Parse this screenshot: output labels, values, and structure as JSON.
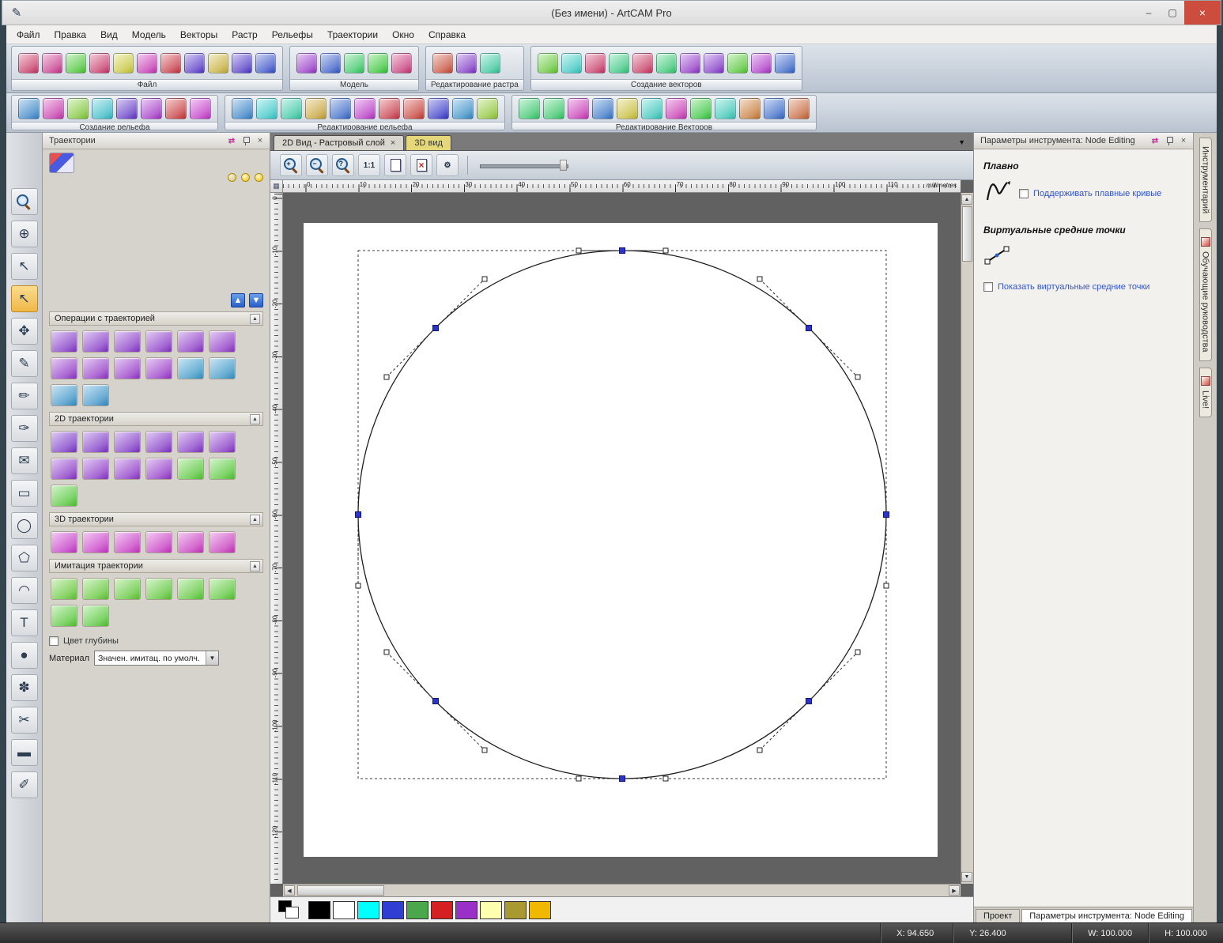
{
  "window": {
    "title": "(Без имени) - ArtCAM Pro"
  },
  "menu": {
    "items": [
      {
        "name": "file",
        "label": "Файл"
      },
      {
        "name": "edit",
        "label": "Правка"
      },
      {
        "name": "view",
        "label": "Вид"
      },
      {
        "name": "model",
        "label": "Модель"
      },
      {
        "name": "vectors",
        "label": "Векторы"
      },
      {
        "name": "bitmap",
        "label": "Растр"
      },
      {
        "name": "reliefs",
        "label": "Рельефы"
      },
      {
        "name": "toolpaths",
        "label": "Траектории"
      },
      {
        "name": "window",
        "label": "Окно"
      },
      {
        "name": "help",
        "label": "Справка"
      }
    ]
  },
  "toolbar_row1": {
    "groups": [
      {
        "label": "Файл",
        "icons": [
          "new-model",
          "open-model",
          "save-model",
          "cut",
          "copy",
          "paste",
          "undo",
          "redo",
          "notes",
          "reference-help",
          "context-help"
        ]
      },
      {
        "label": "Модель",
        "icons": [
          "greyscale-model",
          "invert-model",
          "bitmap-model",
          "emboss-model",
          "wrap-model"
        ]
      },
      {
        "label": "Редактирование растра",
        "icons": [
          "draw-bitmap",
          "bitmap-to-vector",
          "vector-doctor"
        ]
      },
      {
        "label": "Создание векторов",
        "icons": [
          "wizard-star",
          "bit-pattern",
          "point-chain",
          "arc-create",
          "snip-vector",
          "measure-vector",
          "offset-vector",
          "fillet-vector",
          "nesting",
          "text-abc",
          "envelope-distort"
        ]
      }
    ]
  },
  "toolbar_row2": {
    "groups": [
      {
        "label": "Создание рельефа",
        "icons": [
          "shape-editor",
          "extrude-relief",
          "turn-relief",
          "two-rail-sweep",
          "swept-profile",
          "weave-wizard",
          "angled-plane",
          "texture-relief"
        ]
      },
      {
        "label": "Редактирование рельефа",
        "icons": [
          "smooth-relief",
          "sculpt-relief",
          "relief-envelope",
          "spin-relief",
          "offset-relief",
          "relief-clipart",
          "paste-relief",
          "scale-relief",
          "mirror-relief",
          "relief-layer",
          "greyscale-edit"
        ]
      },
      {
        "label": "Редактирование Векторов",
        "icons": [
          "add-node",
          "create-ellipse",
          "ring-text",
          "wave-distort",
          "vector-texture",
          "arc-fit",
          "bell-wrap",
          "mesh-creator",
          "blend-vectors",
          "join-vectors",
          "trim-vectors",
          "transform-box"
        ]
      }
    ]
  },
  "left_toolbox": {
    "active": "node-editing",
    "tools": [
      {
        "name": "zoom",
        "glyph": "mag"
      },
      {
        "name": "pan-view",
        "glyph": "⊕"
      },
      {
        "name": "select-vectors",
        "glyph": "↖"
      },
      {
        "name": "node-editing",
        "glyph": "↖"
      },
      {
        "name": "transform-vectors",
        "glyph": "✥"
      },
      {
        "name": "measure",
        "glyph": "✎"
      },
      {
        "name": "draw-vector",
        "glyph": "✏"
      },
      {
        "name": "smudge",
        "glyph": "✑"
      },
      {
        "name": "envelope",
        "glyph": "✉"
      },
      {
        "name": "rectangle-create",
        "glyph": "▭"
      },
      {
        "name": "ellipse-create",
        "glyph": "◯"
      },
      {
        "name": "polygon-create",
        "glyph": "⬠"
      },
      {
        "name": "arc-create",
        "glyph": "◠"
      },
      {
        "name": "text-create",
        "glyph": "T"
      },
      {
        "name": "droplet",
        "glyph": "●"
      },
      {
        "name": "flower-sculpt",
        "glyph": "✽"
      },
      {
        "name": "knife",
        "glyph": "✂"
      },
      {
        "name": "eraser",
        "glyph": "▬"
      },
      {
        "name": "paint",
        "glyph": "✐"
      }
    ]
  },
  "left_panel": {
    "title": "Траектории",
    "sections": [
      {
        "label": "Операции с траекторией",
        "icon_count": 14
      },
      {
        "label": "2D траектории",
        "icon_count": 13
      },
      {
        "label": "3D траектории",
        "icon_count": 6
      },
      {
        "label": "Имитация траектории",
        "icon_count": 8
      }
    ],
    "depth_color_label": "Цвет глубины",
    "material_label": "Материал",
    "material_value": "Значен. имитац. по умолч."
  },
  "canvas": {
    "tabs": [
      {
        "label": "2D Вид - Растровый слой"
      },
      {
        "label": "3D вид"
      }
    ],
    "ruler_unit": "millimetres",
    "h_ticks": [
      "0",
      "10",
      "20",
      "30",
      "40",
      "50",
      "60",
      "70",
      "80",
      "90",
      "100",
      "110"
    ],
    "v_ticks": [
      "0",
      "-10",
      "-20",
      "-30",
      "-40",
      "-50",
      "-60",
      "-70",
      "-80",
      "-90",
      "-100",
      "-110",
      "-120"
    ],
    "view_icons": [
      "zoom-in",
      "zoom-out",
      "zoom-help",
      "zoom-1to1",
      "zoom-page",
      "zoom-object",
      "render-quality"
    ]
  },
  "right_panel": {
    "title": "Параметры инструмента: Node Editing",
    "smooth_heading": "Плавно",
    "smooth_option": "Поддерживать плавные кривые",
    "midpoint_heading": "Виртуальные средние точки",
    "midpoint_option": "Показать виртуальные средние точки"
  },
  "side_tabs": [
    {
      "name": "toolbox",
      "label": "Инструментарий"
    },
    {
      "name": "tutorials",
      "label": "Обучающие руководства"
    },
    {
      "name": "live",
      "label": "Live!"
    }
  ],
  "bottom_tabs": [
    {
      "name": "project",
      "label": "Проект"
    },
    {
      "name": "tool-settings",
      "label": "Параметры инструмента: Node Editing"
    }
  ],
  "status": {
    "x": "X: 94.650",
    "y": "Y: 26.400",
    "w": "W: 100.000",
    "h": "H: 100.000"
  },
  "palette": {
    "colors": [
      "#000000",
      "#ffffff",
      "#00ffff",
      "#2f3fd3",
      "#4aa84a",
      "#d42020",
      "#9a30c8",
      "#ffffb0",
      "#a89a30",
      "#f0b800"
    ]
  }
}
